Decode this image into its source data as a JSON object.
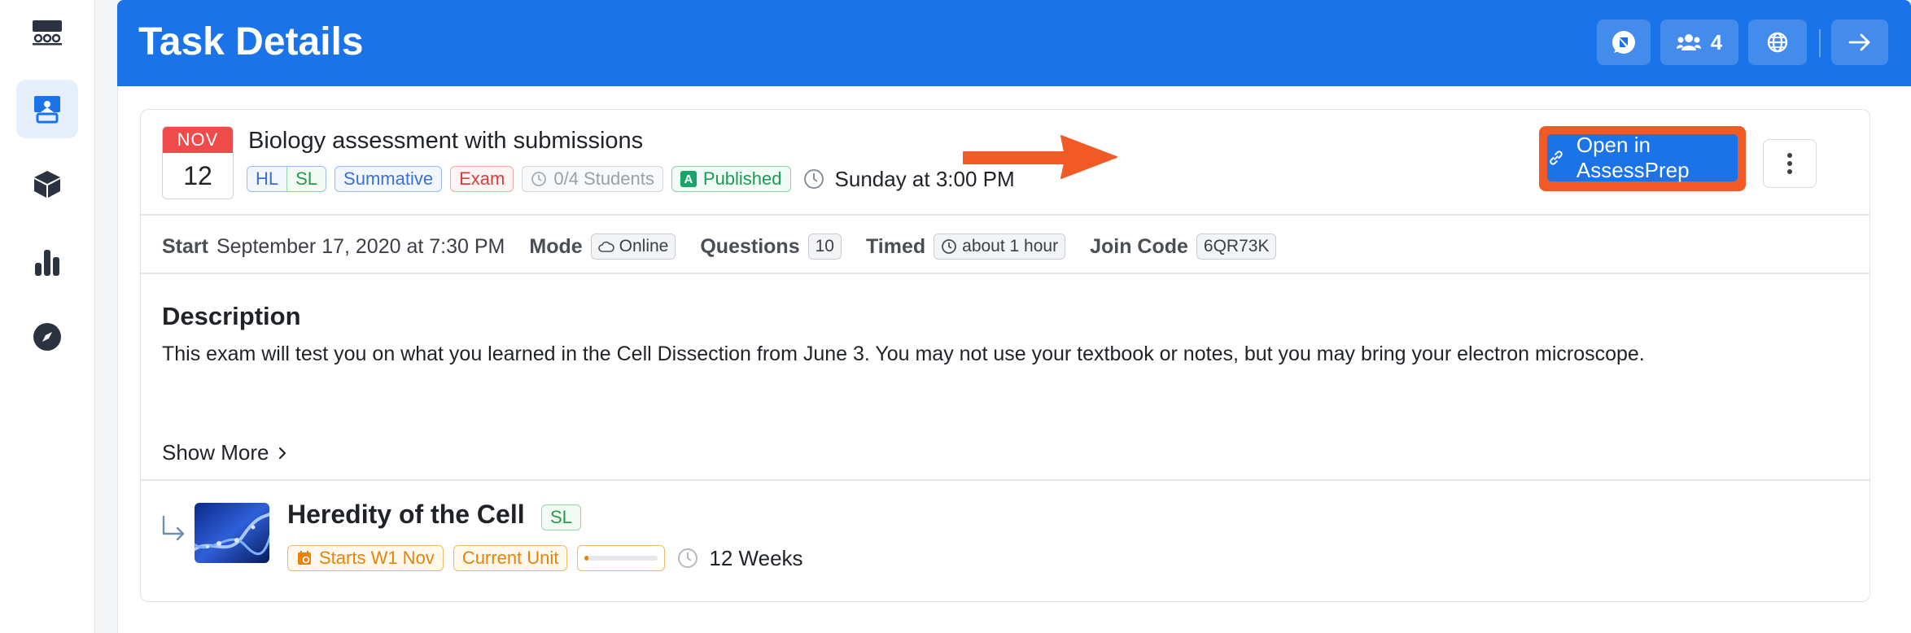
{
  "sidebar": {
    "items": [
      {
        "icon": "classroom-icon"
      },
      {
        "icon": "teacher-presentation-icon",
        "active": true
      },
      {
        "icon": "cube-icon"
      },
      {
        "icon": "bar-chart-icon"
      },
      {
        "icon": "compass-icon"
      }
    ]
  },
  "header": {
    "title": "Task Details",
    "members_count": "4",
    "buttons": [
      "chat-icon",
      "users-icon",
      "globe-icon",
      "arrow-right-icon"
    ],
    "color": "#1a73e8"
  },
  "task": {
    "month": "NOV",
    "day": "12",
    "title": "Biology assessment with submissions",
    "tags": {
      "hl": "HL",
      "sl": "SL",
      "type": "Summative",
      "category": "Exam",
      "students": "0/4 Students",
      "status_letter": "A",
      "status": "Published"
    },
    "due": "Sunday at 3:00 PM",
    "open_button": "Open in AssessPrep"
  },
  "meta": {
    "start_label": "Start",
    "start_value": "September 17, 2020 at 7:30 PM",
    "mode_label": "Mode",
    "mode_value": "Online",
    "questions_label": "Questions",
    "questions_value": "10",
    "timed_label": "Timed",
    "timed_value": "about 1 hour",
    "join_label": "Join Code",
    "join_value": "6QR73K"
  },
  "description": {
    "heading": "Description",
    "text": "This exam will test you on what you learned in the Cell Dissection from June 3. You may not use your textbook or notes, but you may bring your electron microscope.",
    "show_more": "Show More"
  },
  "unit": {
    "title": "Heredity of the Cell",
    "level": "SL",
    "starts": "Starts W1 Nov",
    "current": "Current Unit",
    "progress": 0.05,
    "duration": "12 Weeks"
  },
  "colors": {
    "accent": "#1a73e8",
    "highlight": "#f15a24",
    "date_red": "#ef4b4b",
    "orange": "#e5830b"
  }
}
